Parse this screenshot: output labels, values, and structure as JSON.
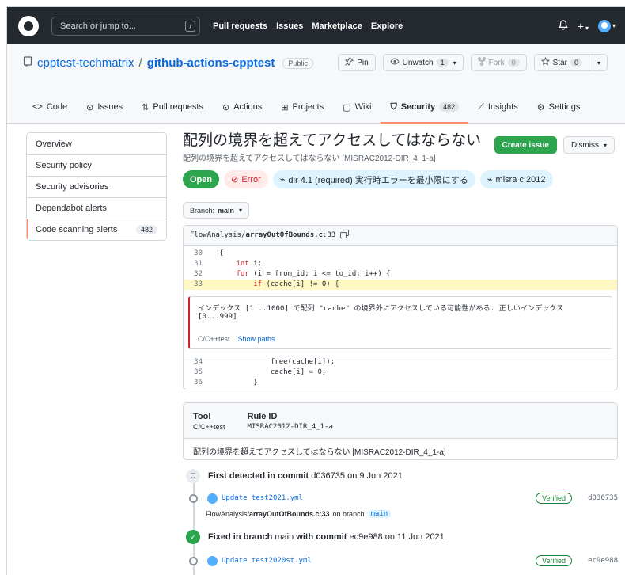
{
  "header": {
    "search_placeholder": "Search or jump to...",
    "search_key": "/",
    "nav": [
      "Pull requests",
      "Issues",
      "Marketplace",
      "Explore"
    ],
    "bell_icon": "bell-icon",
    "plus": "+"
  },
  "repo": {
    "owner": "cpptest-techmatrix",
    "separator": "/",
    "name": "github-actions-cpptest",
    "visibility": "Public",
    "pin_label": "Pin",
    "unwatch_label": "Unwatch",
    "unwatch_count": "1",
    "fork_label": "Fork",
    "fork_count": "0",
    "star_label": "Star",
    "star_count": "0"
  },
  "tabs": [
    {
      "label": "Code",
      "icon": "code-icon"
    },
    {
      "label": "Issues",
      "icon": "issue-icon"
    },
    {
      "label": "Pull requests",
      "icon": "pull-request-icon"
    },
    {
      "label": "Actions",
      "icon": "play-icon"
    },
    {
      "label": "Projects",
      "icon": "table-icon"
    },
    {
      "label": "Wiki",
      "icon": "book-icon"
    },
    {
      "label": "Security",
      "icon": "shield-icon",
      "count": "482",
      "selected": true
    },
    {
      "label": "Insights",
      "icon": "graph-icon"
    },
    {
      "label": "Settings",
      "icon": "gear-icon"
    }
  ],
  "sidebar": {
    "items": [
      {
        "label": "Overview"
      },
      {
        "label": "Security policy"
      },
      {
        "label": "Security advisories"
      },
      {
        "label": "Dependabot alerts"
      },
      {
        "label": "Code scanning alerts",
        "count": "482",
        "selected": true
      }
    ]
  },
  "alert": {
    "title": "配列の境界を超えてアクセスしてはならない",
    "subtitle": "配列の境界を超えてアクセスしてはならない [MISRAC2012-DIR_4_1-a]",
    "create_issue": "Create issue",
    "dismiss": "Dismiss",
    "status": "Open",
    "severity": "Error",
    "tags": [
      "dir 4.1 (required) 実行時エラーを最小限にする",
      "misra c 2012"
    ],
    "branch_label": "Branch:",
    "branch_value": "main"
  },
  "code": {
    "dir": "FlowAnalysis/",
    "file": "arrayOutOfBounds.c",
    "line_ref": ":33",
    "before": [
      {
        "n": "30",
        "t": "  {"
      },
      {
        "n": "31",
        "t": "      int i;"
      },
      {
        "n": "32",
        "t": "      for (i = from_id; i <= to_id; i++) {"
      },
      {
        "n": "33",
        "t": "          if (cache[i] != 0) {"
      }
    ],
    "message": "インデックス [1...1000] で配列 \"cache\" の境界外にアクセスしている可能性がある. 正しいインデックス [0...999]",
    "tool_name": "C/C++test",
    "show_paths": "Show paths",
    "after": [
      {
        "n": "34",
        "t": "              free(cache[i]);"
      },
      {
        "n": "35",
        "t": "              cache[i] = 0;"
      },
      {
        "n": "36",
        "t": "          }"
      }
    ]
  },
  "info": {
    "tool_header": "Tool",
    "tool_value": "C/C++test",
    "rule_header": "Rule ID",
    "rule_value": "MISRAC2012-DIR_4_1-a",
    "description": "配列の境界を超えてアクセスしてはならない [MISRAC2012-DIR_4_1-a]"
  },
  "timeline": {
    "first_bold": "First detected in commit",
    "first_rest": "d036735 on 9 Jun 2021",
    "commit1": {
      "message": "Update test2021.yml",
      "verified": "Verified",
      "sha": "d036735"
    },
    "fileref_path": "FlowAnalysis/",
    "fileref_file": "arrayOutOfBounds.c:33",
    "fileref_on": "on branch",
    "fileref_branch": "main",
    "fixed_bold1": "Fixed in branch",
    "fixed_mid": "main",
    "fixed_bold2": "with commit",
    "fixed_rest": "ec9e988 on 11 Jun 2021",
    "commit2": {
      "message": "Update test2020st.yml",
      "verified": "Verified",
      "sha": "ec9e988"
    }
  }
}
